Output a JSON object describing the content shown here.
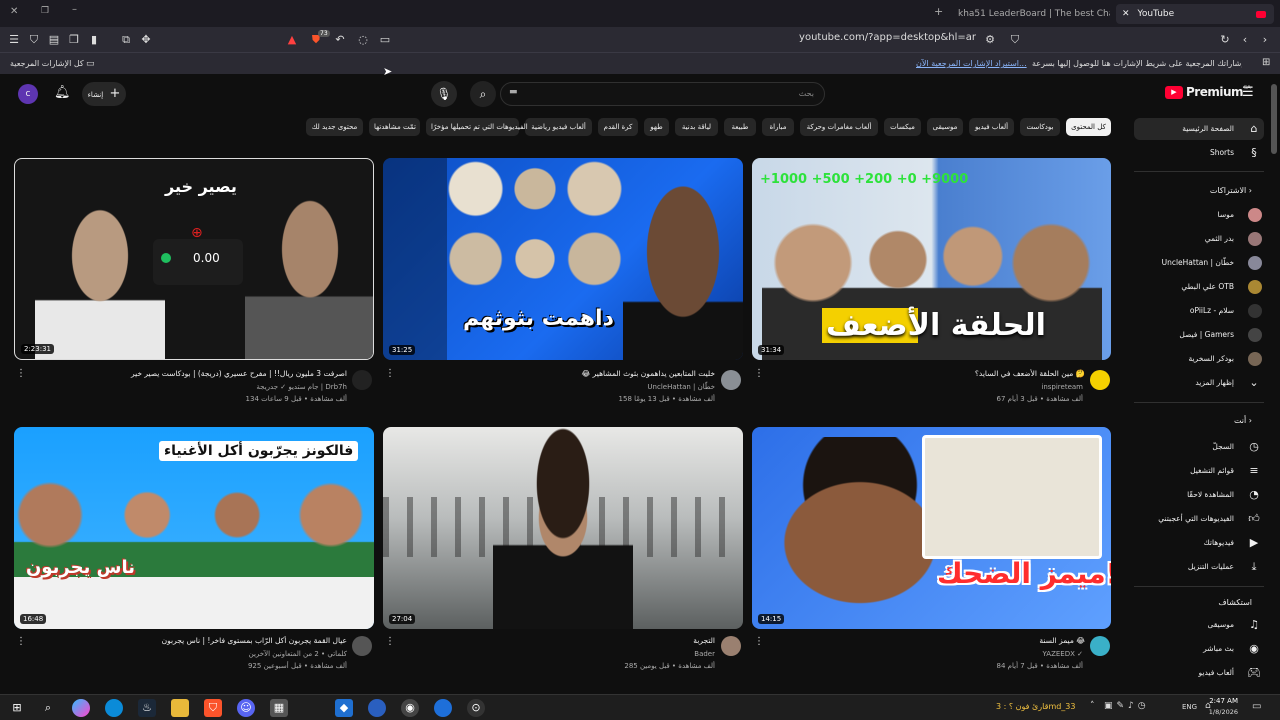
{
  "browser": {
    "tabs": [
      {
        "label": "kha51 LeaderBoard | The best ChatGP"
      },
      {
        "label": "YouTube"
      }
    ],
    "url": "youtube.com/?app=desktop&hl=ar",
    "bookmarks_hint": "ضع إشاراتك المرجعية على شريط الإشارات هنا للوصول إليها بسرعة.",
    "bookmarks_import": "استيراد الإشارات المرجعية الآن...",
    "all_bookmarks": "كل الإشارات المرجعية",
    "shield_badge": "73"
  },
  "youtube": {
    "logo": "Premium",
    "logo_region": "SA",
    "search_placeholder": "بحث",
    "create_label": "إنشاء",
    "avatar_letter": "c",
    "chips": [
      {
        "label": "كل المحتوى",
        "active": true
      },
      {
        "label": "بودكاست"
      },
      {
        "label": "ألعاب فيديو"
      },
      {
        "label": "موسيقى"
      },
      {
        "label": "ميكسات"
      },
      {
        "label": "ألعاب مغامرات وحركة"
      },
      {
        "label": "مباراة"
      },
      {
        "label": "طبيعة"
      },
      {
        "label": "لياقة بدنية"
      },
      {
        "label": "طهو"
      },
      {
        "label": "كرة القدم"
      },
      {
        "label": "ألعاب فيديو رياضية"
      },
      {
        "label": "الفيديوهات التي تم تحميلها مؤخرًا"
      },
      {
        "label": "تمّت مشاهدتها"
      },
      {
        "label": "محتوى جديد لك"
      }
    ],
    "sidebar": {
      "main": [
        {
          "label": "الصفحة الرئيسية",
          "icon": "home-icon"
        },
        {
          "label": "Shorts",
          "icon": "shorts-icon"
        }
      ],
      "subscriptions_title": "الاشتراكات",
      "subscriptions": [
        {
          "label": "موسا"
        },
        {
          "label": "بدر الثمي"
        },
        {
          "label": "UncleHattan | خطّان"
        },
        {
          "label": "علي البطي OTB"
        },
        {
          "label": "oPiiLz - سلام"
        },
        {
          "label": "فيصل | Gamers"
        },
        {
          "label": "بودكر السخرية"
        },
        {
          "label": "إظهار المزيد"
        }
      ],
      "you_title": "أنت",
      "you": [
        {
          "label": "السجلّ",
          "icon": "history-icon"
        },
        {
          "label": "قوائم التشغيل",
          "icon": "playlist-icon"
        },
        {
          "label": "المشاهدة لاحقًا",
          "icon": "clock-icon"
        },
        {
          "label": "الفيديوهات التي أعجبتني",
          "icon": "like-icon"
        },
        {
          "label": "فيديوهاتك",
          "icon": "video-icon"
        },
        {
          "label": "عمليات التنزيل",
          "icon": "download-icon"
        }
      ],
      "explore_title": "استكشاف",
      "explore": [
        {
          "label": "موسيقى",
          "icon": "music-icon"
        },
        {
          "label": "بث مباشر",
          "icon": "live-icon"
        },
        {
          "label": "ألعاب فيديو",
          "icon": "gaming-icon"
        }
      ]
    },
    "videos": [
      {
        "title": "مين الحلقة الأضعف في السايد؟ 🤔",
        "channel": "inspireteam",
        "meta": "67 ألف مشاهدة • قبل 3 أيام",
        "duration": "31:34",
        "thumb_text": "الحلقة الأضعف"
      },
      {
        "title": "😂 خليت المتابعين يداهمون بثوث المشاهير",
        "channel": "UncleHattan | خطّان",
        "meta": "158 ألف مشاهدة • قبل 13 يومًا",
        "duration": "31:25",
        "thumb_text": "داهمت بثوثهم"
      },
      {
        "title": "اصرفت 3 مليون ريال!! | مفرح عسيري (دريجة) | بودكاست يصير خير",
        "channel": "جام ستديو ✓ جدريجة | Drb7h",
        "meta": "134 ألف مشاهدة • قبل 9 ساعات",
        "duration": "2:23:31",
        "thumb_text": "يصير خير",
        "thumb_amount": "0.00"
      },
      {
        "title": "ميمز السنة 😂",
        "channel": "YAZEEDX ✓",
        "meta": "84 ألف مشاهدة • قبل 7 أيام",
        "duration": "14:15",
        "thumb_text": "ميمز الضحك!"
      },
      {
        "title": "التجربة",
        "channel": "Bader",
        "meta": "285 ألف مشاهدة • قبل يومين",
        "duration": "27:04",
        "thumb_text": ""
      },
      {
        "title": "عيال القمة يجربون أكل الرّاب بمستوى فاخر! | ناس يجربون",
        "channel": "كلماتي • 2 من المتعاونين الآخرين",
        "meta": "925 ألف مشاهدة • قبل أسبوعين",
        "duration": "16:48",
        "thumb_text": "فالكونز يجرّبون أكل الأغنياء",
        "thumb_text2": "ناس يجربون"
      }
    ]
  },
  "taskbar": {
    "lang": "ENG",
    "time": "2:47 AM",
    "date": "1/8/2026",
    "notif": "قارئ فون ؟ : 3md_33"
  },
  "colors": {
    "accent_red": "#ff0033",
    "bg": "#0f0f0f",
    "chip": "#272727"
  }
}
